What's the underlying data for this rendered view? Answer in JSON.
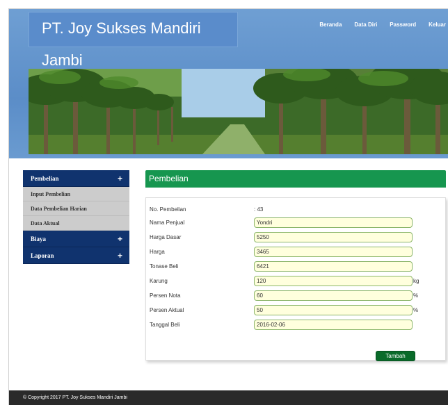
{
  "header": {
    "brand": "PT. Joy Sukses Mandiri Jambi",
    "nav": [
      "Beranda",
      "Data Diri",
      "Password",
      "Keluar"
    ]
  },
  "sidebar": {
    "groups": [
      {
        "label": "Pembelian",
        "toggle": "+",
        "items": [
          "Input Pembelian",
          "Data Pembelian Harian",
          "Data Aktual"
        ]
      },
      {
        "label": "Biaya",
        "toggle": "+"
      },
      {
        "label": "Laporan",
        "toggle": "+"
      }
    ]
  },
  "main": {
    "title": "Pembelian",
    "form": {
      "no_pembelian_label": "No. Pembelian",
      "no_pembelian_value": ": 43",
      "fields": [
        {
          "label": "Nama Penjual",
          "value": "Yondri",
          "unit": ""
        },
        {
          "label": "Harga Dasar",
          "value": "5250",
          "unit": ""
        },
        {
          "label": "Harga",
          "value": "3465",
          "unit": ""
        },
        {
          "label": "Tonase Beli",
          "value": "6421",
          "unit": ""
        },
        {
          "label": "Karung",
          "value": "120",
          "unit": "kg"
        },
        {
          "label": "Persen Nota",
          "value": "60",
          "unit": "%"
        },
        {
          "label": "Persen Aktual",
          "value": "50",
          "unit": "%"
        },
        {
          "label": "Tanggal Beli",
          "value": "2016-02-06",
          "unit": ""
        }
      ],
      "submit_label": "Tambah"
    }
  },
  "footer": {
    "copyright": "© Copyright 2017 PT. Joy Sukses Mandiri Jambi"
  },
  "colors": {
    "header_blue": "#5b8dc8",
    "sidebar_navy": "#10336e",
    "section_green": "#16964f",
    "button_green": "#0a6b2a",
    "input_bg": "#ffffdd"
  }
}
